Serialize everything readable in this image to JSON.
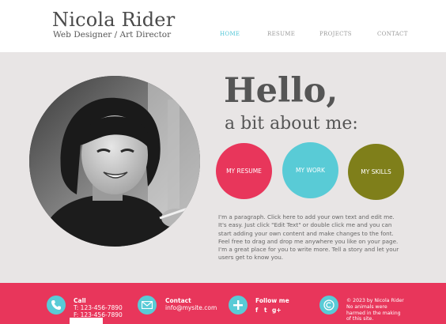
{
  "header": {
    "title": "Nicola Rider",
    "subtitle": "Web Designer / Art Director",
    "nav": [
      {
        "label": "HOME",
        "active": true
      },
      {
        "label": "RESUME",
        "active": false
      },
      {
        "label": "PROJECTS",
        "active": false
      },
      {
        "label": "CONTACT",
        "active": false
      }
    ]
  },
  "main": {
    "hello": "Hello,",
    "about": "a bit about me:",
    "buttons": [
      {
        "label": "MY RESUME",
        "color": "#e8365b"
      },
      {
        "label": "MY WORK",
        "color": "#59cbd6"
      },
      {
        "label": "MY SKILLS",
        "color": "#7f7f1a"
      }
    ],
    "paragraph": "I'm a paragraph. Click here to add your own text and edit me. It's easy. Just click \"Edit Text\" or double click me and you can start adding your own content and make changes to the font. Feel free to drag and drop me anywhere you like on your page. I'm a great place for you to write more. Tell a story and let your users get to know you."
  },
  "footer": {
    "call": {
      "heading": "Call",
      "line1": "T: 123-456-7890",
      "line2": "F: 123-456-7890",
      "icon": "phone-icon"
    },
    "contact": {
      "heading": "Contact",
      "line1": "info@mysite.com",
      "icon": "envelope-icon"
    },
    "follow": {
      "heading": "Follow me",
      "icon": "plus-icon",
      "social": [
        "f",
        "t",
        "g+"
      ]
    },
    "copyright": {
      "line1": "© 2023 by Nicola Rider",
      "line2": "No animals were harmed in the making of this site.",
      "icon": "copyright-icon"
    }
  },
  "colors": {
    "accent_pink": "#e8365b",
    "accent_cyan": "#59cbd6",
    "accent_olive": "#7f7f1a",
    "main_background": "#e8e5e5",
    "nav_active": "#4ec5d6"
  }
}
